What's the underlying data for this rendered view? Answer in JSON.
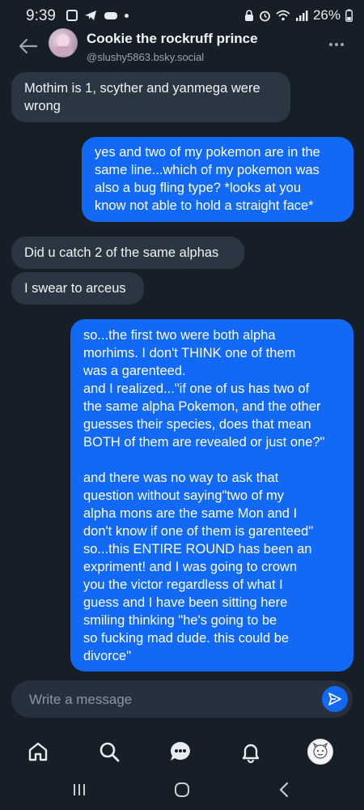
{
  "status_bar": {
    "time": "9:39",
    "battery": "26%"
  },
  "header": {
    "title": "Cookie the rockruff prince",
    "handle": "@slushy5863.bsky.social"
  },
  "messages": [
    {
      "side": "incoming",
      "lines": [
        "Mothim is 1, scyther and yanmega were",
        "wrong"
      ]
    },
    {
      "side": "outgoing",
      "lines": [
        "yes and two of my pokemon are in the",
        "same line...which of my pokemon was",
        "also a bug fling type? *looks at you",
        "know not able to hold a straight face*"
      ]
    },
    {
      "side": "incoming",
      "lines": [
        "Did u catch 2 of the same alphas"
      ]
    },
    {
      "side": "incoming",
      "lines": [
        "I swear to arceus"
      ]
    },
    {
      "side": "outgoing",
      "lines": [
        "so...the first two were both alpha",
        "morhims. I don't THINK one of them",
        "was a garenteed.",
        "and I realized...\"if one of us has two of",
        "the same alpha Pokemon, and the other",
        "guesses their species, does that mean",
        "BOTH of them are revealed or just one?\"",
        "",
        "and there was no way to ask that",
        "question without saying\"two of my",
        "alpha mons are the same Mon and I",
        "don't know if one of them is garenteed\"",
        "so...this ENTIRE ROUND has been an",
        "expriment! and I was going to crown",
        "you the victor regardless of what I",
        "guess and I have been sitting here",
        "smiling thinking \"he's going to be",
        "so fucking mad dude. this could be",
        "divorce\""
      ]
    }
  ],
  "composer": {
    "placeholder": "Write a message"
  },
  "tabs": [
    "home-icon",
    "search-icon",
    "chat-icon",
    "bell-icon",
    "profile-avatar"
  ],
  "colors": {
    "background": "#161e27",
    "incoming_bubble": "#2b3643",
    "outgoing_bubble": "#1169f6",
    "accent": "#1169f6"
  }
}
